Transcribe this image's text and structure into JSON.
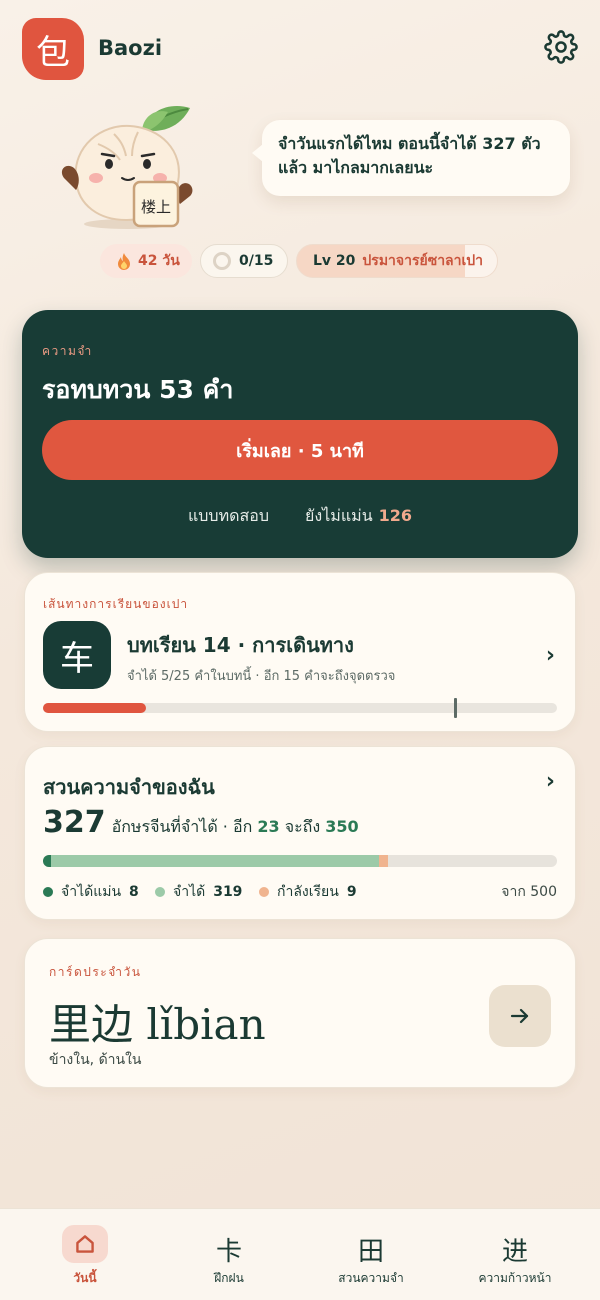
{
  "header": {
    "logo_glyph": "包",
    "app_name": "Baozi",
    "settings_icon": "gear-icon"
  },
  "mascot": {
    "sign_text": "楼上",
    "speech": "จำวันแรกได้ไหม ตอนนี้จำได้ 327 ตัว แล้ว มาไกลมากเลยนะ"
  },
  "stats": {
    "streak_icon": "fire-icon",
    "streak_label": "42 วัน",
    "goal_label": "0/15",
    "goal_progress": 0,
    "level_label": "Lv 20",
    "level_title": "ปรมาจารย์ซาลาเปา",
    "level_progress": 0.84
  },
  "review": {
    "kicker": "ความจำ",
    "heading": "รอทบทวน 53 คำ",
    "start_button": "เริ่มเลย · 5 นาที",
    "quiz_link": "แบบทดสอบ",
    "unsure_label": "ยังไม่แม่น",
    "unsure_count": "126"
  },
  "path": {
    "kicker": "เส้นทางการเรียนของเปา",
    "lesson_glyph": "车",
    "title": "บทเรียน 14 · การเดินทาง",
    "subtitle": "จำได้ 5/25 คำในบทนี้ · อีก 15 คำจะถึงจุดตรวจ",
    "progress": 0.2,
    "checkpoint": 0.8,
    "chevron": "›"
  },
  "garden": {
    "title": "สวนความจำของฉัน",
    "count": "327",
    "count_text_prefix": "อักษรจีนที่จำได้ · อีก ",
    "count_text_num": "23",
    "count_text_mid": " จะถึง ",
    "count_text_target": "350",
    "chevron": "›",
    "segments": [
      {
        "label": "จำได้แม่น",
        "count": "8",
        "value": 8,
        "color": "#2b7a55"
      },
      {
        "label": "จำได้",
        "count": "319",
        "value": 319,
        "color": "#9ccaa8"
      },
      {
        "label": "กำลังเรียน",
        "count": "9",
        "value": 9,
        "color": "#f0b48f"
      }
    ],
    "total_label": "จาก 500",
    "total_value": 500
  },
  "daily": {
    "kicker": "การ์ดประจำวัน",
    "word": "里边 lǐbian",
    "meaning": "ข้างใน, ด้านใน",
    "arrow_icon": "arrow-right-icon"
  },
  "tabs": [
    {
      "glyph": "⌂",
      "label": "วันนี้",
      "active": true
    },
    {
      "glyph": "卡",
      "label": "ฝึกฝน",
      "active": false
    },
    {
      "glyph": "田",
      "label": "สวนความจำ",
      "active": false
    },
    {
      "glyph": "进",
      "label": "ความก้าวหน้า",
      "active": false
    }
  ]
}
